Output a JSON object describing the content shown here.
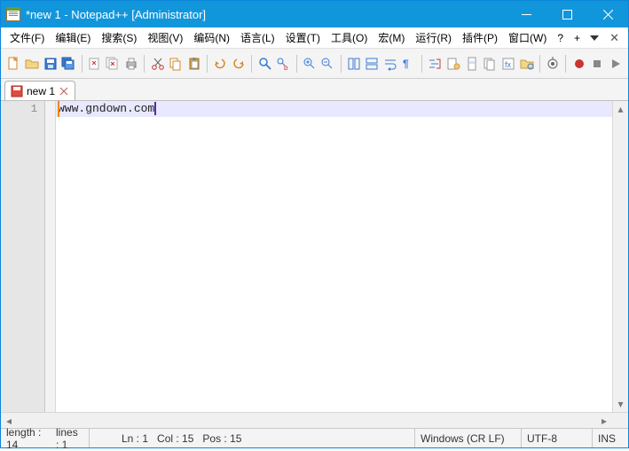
{
  "title": "*new 1 - Notepad++ [Administrator]",
  "menu": {
    "file": "文件(F)",
    "edit": "编辑(E)",
    "search": "搜索(S)",
    "view": "视图(V)",
    "encoding": "编码(N)",
    "language": "语言(L)",
    "settings": "设置(T)",
    "tools": "工具(O)",
    "macro": "宏(M)",
    "run": "运行(R)",
    "plugins": "插件(P)",
    "window": "窗口(W)",
    "help": "?",
    "plus": "+"
  },
  "tab": {
    "label": "new 1"
  },
  "editor": {
    "line_number": "1",
    "content": "www.gndown.com"
  },
  "status": {
    "length": "length : 14",
    "lines": "lines : 1",
    "ln": "Ln : 1",
    "col": "Col : 15",
    "pos": "Pos : 15",
    "eol": "Windows (CR LF)",
    "enc": "UTF-8",
    "ins": "INS"
  }
}
